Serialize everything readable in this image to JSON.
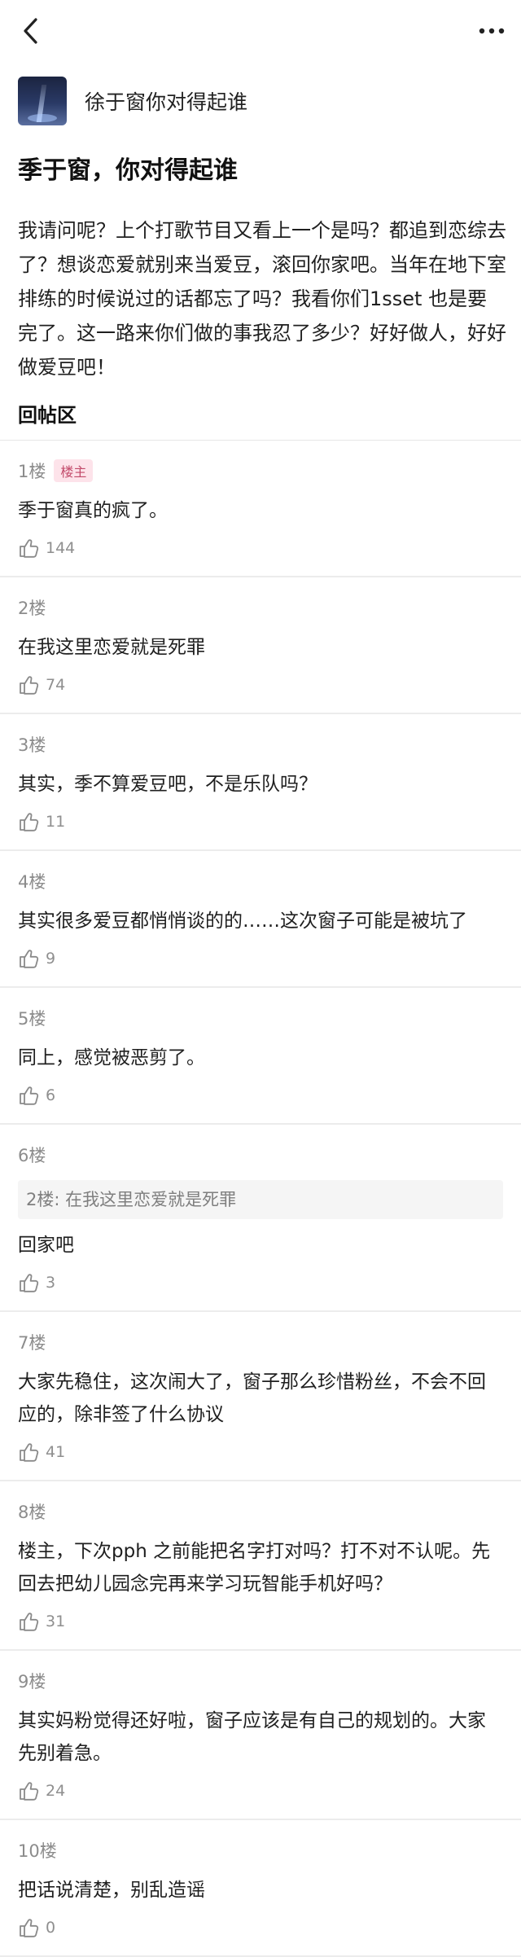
{
  "nav": {
    "back_icon": "chevron-left-icon",
    "more_icon": "more-horizontal-icon"
  },
  "author": {
    "name": "徐于窗你对得起谁"
  },
  "post": {
    "title": "季于窗，你对得起谁",
    "body": "我请问呢？上个打歌节目又看上一个是吗？都追到恋综去了？想谈恋爱就别来当爱豆，滚回你家吧。当年在地下室排练的时候说过的话都忘了吗？我看你们1sset 也是要完了。这一路来你们做的事我忍了多少？好好做人，好好做爱豆吧！"
  },
  "replies_section": {
    "title": "回帖区"
  },
  "replies": [
    {
      "floor": "1楼",
      "badge": "楼主",
      "text": "季于窗真的疯了。",
      "likes": "144"
    },
    {
      "floor": "2楼",
      "text": "在我这里恋爱就是死罪",
      "likes": "74"
    },
    {
      "floor": "3楼",
      "text": "其实，季不算爱豆吧，不是乐队吗？",
      "likes": "11"
    },
    {
      "floor": "4楼",
      "text": "其实很多爱豆都悄悄谈的的……这次窗子可能是被坑了",
      "likes": "9"
    },
    {
      "floor": "5楼",
      "text": "同上，感觉被恶剪了。",
      "likes": "6"
    },
    {
      "floor": "6楼",
      "quote": "2楼: 在我这里恋爱就是死罪",
      "text": "回家吧",
      "likes": "3"
    },
    {
      "floor": "7楼",
      "text": "大家先稳住，这次闹大了，窗子那么珍惜粉丝，不会不回应的，除非签了什么协议",
      "likes": "41"
    },
    {
      "floor": "8楼",
      "text": "楼主，下次pph 之前能把名字打对吗？打不对不认呢。先回去把幼儿园念完再来学习玩智能手机好吗？",
      "likes": "31"
    },
    {
      "floor": "9楼",
      "text": "其实妈粉觉得还好啦，窗子应该是有自己的规划的。大家先别着急。",
      "likes": "24"
    },
    {
      "floor": "10楼",
      "text": "把话说清楚，别乱造谣",
      "likes": "0"
    }
  ]
}
